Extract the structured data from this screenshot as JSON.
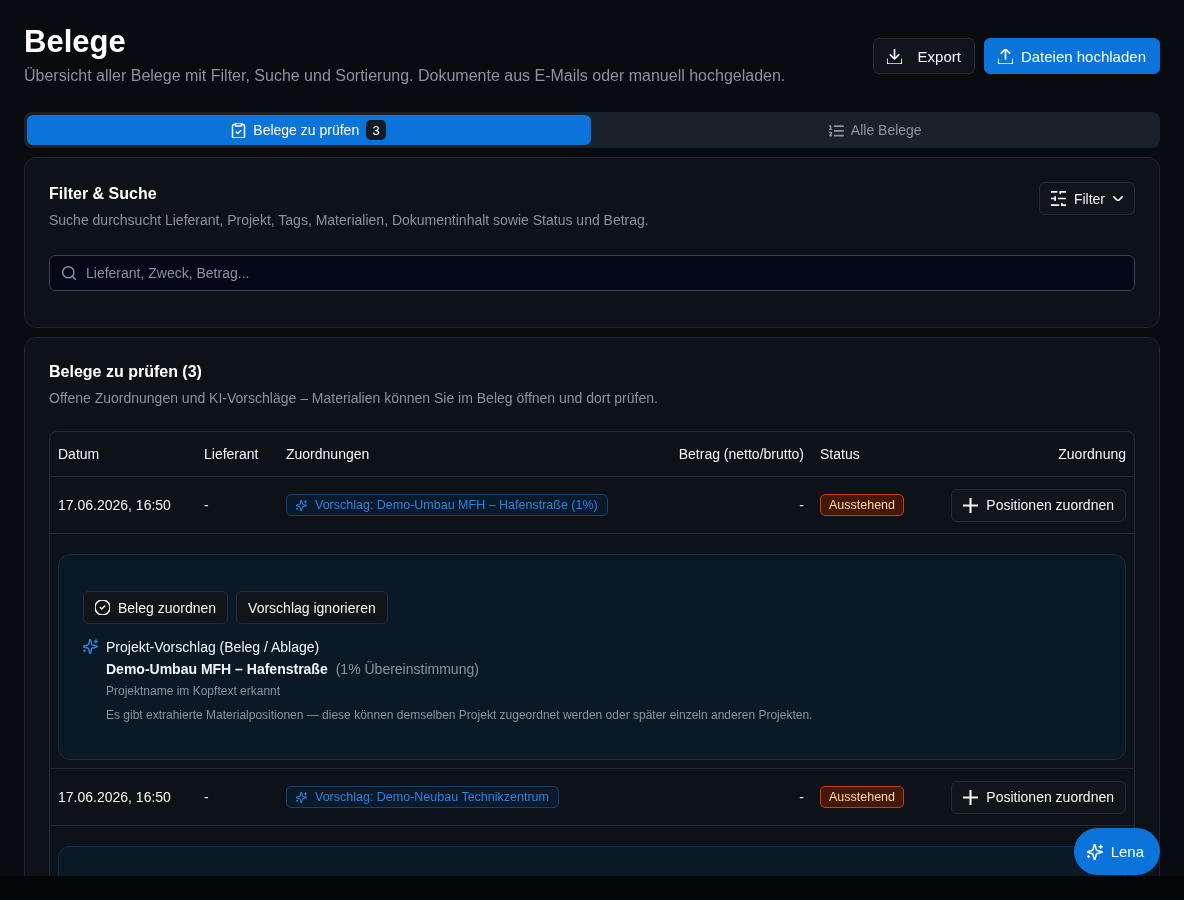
{
  "header": {
    "title": "Belege",
    "subtitle": "Übersicht aller Belege mit Filter, Suche und Sortierung. Dokumente aus E-Mails oder manuell hochgeladen.",
    "export_button": {
      "label": "Export"
    },
    "upload_button": {
      "label": "Dateien hochladen"
    }
  },
  "tabs": [
    {
      "kind": "review",
      "label": "Belege zu prüfen",
      "count": "3",
      "selected": true
    },
    {
      "kind": "all",
      "label": "Alle Belege",
      "selected": false
    }
  ],
  "filter_panel": {
    "title": "Filter & Suche",
    "description": "Suche durchsucht Lieferant, Projekt, Tags, Materialien, Dokumentinhalt sowie Status und Betrag.",
    "filter_button": {
      "label": "Filter"
    },
    "search": {
      "placeholder": "Lieferant, Zweck, Betrag..."
    }
  },
  "review_panel": {
    "title": "Belege zu prüfen (3)",
    "description": "Offene Zuordnungen und KI-Vorschläge – Materialien können Sie im Beleg öffnen und dort prüfen.",
    "table": {
      "columns": [
        "Datum",
        "Lieferant",
        "Zuordnungen",
        "Betrag (netto/brutto)",
        "Status",
        "Zuordnung"
      ],
      "rows": [
        {
          "date": "17.06.2026, 16:50",
          "supplier": "-",
          "assignment": "Vorschlag: Demo-Umbau MFH – Hafenstraße (1%)",
          "amount": "-",
          "status": {
            "kind": "pending",
            "label": "Ausstehend"
          },
          "action": "Positionen zuordnen",
          "expanded": true,
          "suggestion": {
            "actions": [
              {
                "kind": "confirm",
                "label": "Beleg zuordnen"
              },
              {
                "kind": "dismiss",
                "label": "Vorschlag ignorieren"
              }
            ],
            "heading": "Projekt-Vorschlag (Beleg / Ablage)",
            "project": "Demo-Umbau MFH – Hafenstraße",
            "match": "(1% Übereinstimmung)",
            "reason": "Projektname im Kopftext erkannt",
            "note": "Es gibt extrahierte Materialpositionen — diese können demselben Projekt zugeordnet werden oder später einzeln anderen Projekten."
          }
        },
        {
          "date": "17.06.2026, 16:50",
          "supplier": "-",
          "assignment": "Vorschlag: Demo-Neubau Technikzentrum",
          "amount": "-",
          "status": {
            "kind": "pending",
            "label": "Ausstehend"
          },
          "action": "Positionen zuordnen",
          "expanded": true
        }
      ]
    }
  },
  "assistant_button": {
    "label": "Lena"
  }
}
